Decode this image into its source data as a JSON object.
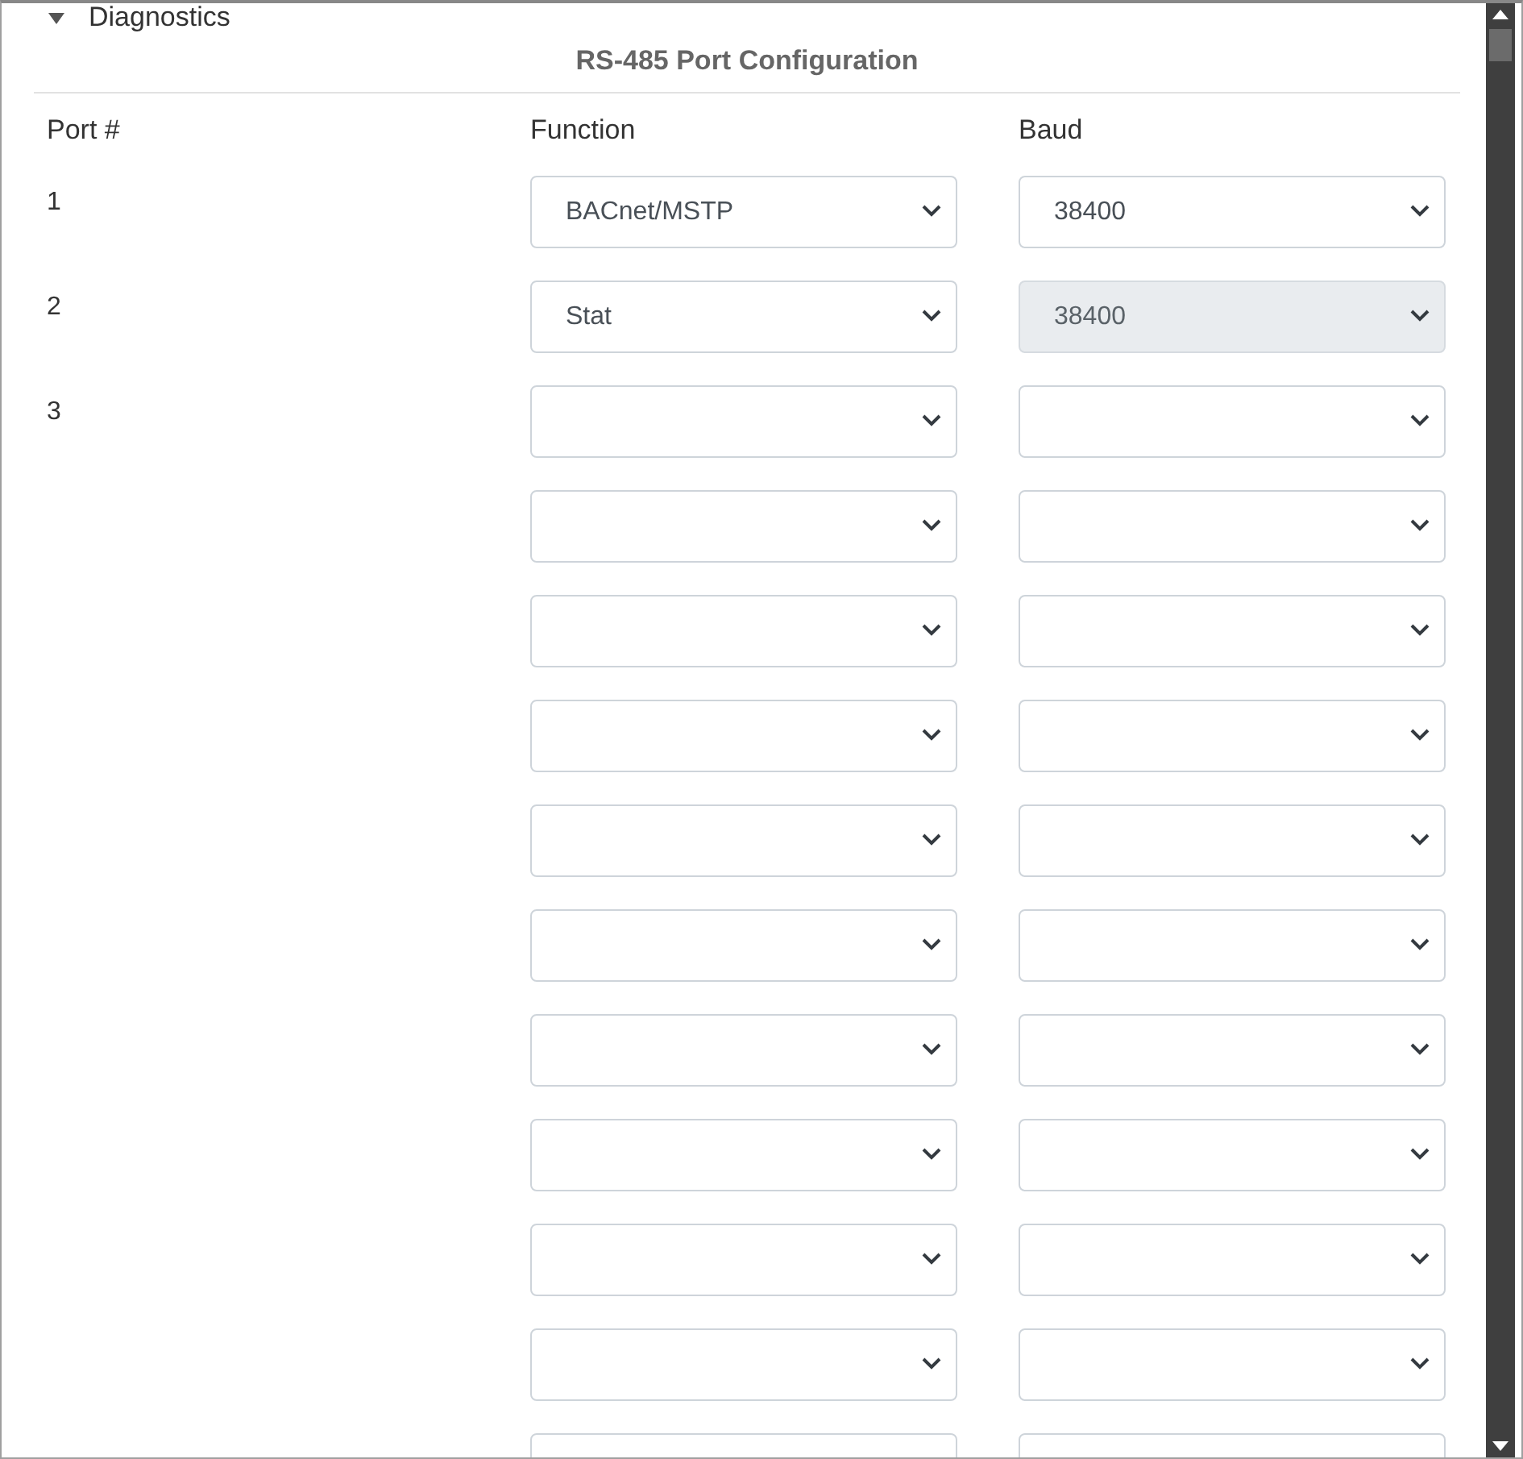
{
  "section": {
    "label": "Diagnostics",
    "expanded": true
  },
  "title": "RS-485 Port Configuration",
  "columns": [
    "Port #",
    "Function",
    "Baud"
  ],
  "rows": [
    {
      "port": "1",
      "function": {
        "value": "BACnet/MSTP",
        "disabled": false
      },
      "baud": {
        "value": "38400",
        "disabled": false
      }
    },
    {
      "port": "2",
      "function": {
        "value": "Stat",
        "disabled": false
      },
      "baud": {
        "value": "38400",
        "disabled": true
      }
    },
    {
      "port": "3",
      "function": {
        "disabled": false
      },
      "baud": {
        "disabled": false
      }
    },
    {
      "function": {
        "disabled": false
      },
      "baud": {
        "disabled": false
      }
    },
    {
      "function": {
        "disabled": false
      },
      "baud": {
        "disabled": false
      }
    },
    {
      "function": {
        "disabled": false
      },
      "baud": {
        "disabled": false
      }
    },
    {
      "function": {
        "disabled": false
      },
      "baud": {
        "disabled": false
      }
    },
    {
      "function": {
        "disabled": false
      },
      "baud": {
        "disabled": false
      }
    },
    {
      "function": {
        "disabled": false
      },
      "baud": {
        "disabled": false
      }
    },
    {
      "function": {
        "disabled": false
      },
      "baud": {
        "disabled": false
      }
    },
    {
      "function": {
        "disabled": false
      },
      "baud": {
        "disabled": false
      }
    },
    {
      "function": {
        "disabled": false
      },
      "baud": {
        "disabled": false
      }
    },
    {
      "function": {
        "disabled": false
      },
      "baud": {
        "disabled": false
      }
    }
  ]
}
